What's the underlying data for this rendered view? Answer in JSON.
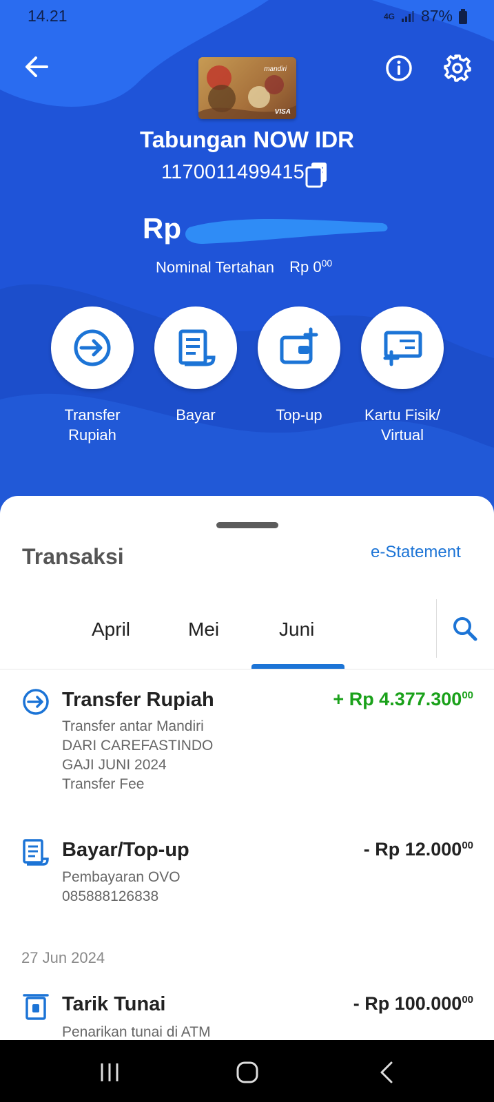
{
  "status_bar": {
    "time": "14.21",
    "network": "4G",
    "battery": "87%"
  },
  "account": {
    "title": "Tabungan NOW IDR",
    "number": "1170011499415",
    "balance_prefix": "Rp",
    "held_label": "Nominal Tertahan",
    "held_amount": "Rp 0",
    "held_cents": "00",
    "card_brand": "VISA",
    "card_bank": "mandiri"
  },
  "actions": [
    {
      "label_line1": "Transfer",
      "label_line2": "Rupiah",
      "icon": "transfer-icon"
    },
    {
      "label_line1": "Bayar",
      "label_line2": "",
      "icon": "bill-icon"
    },
    {
      "label_line1": "Top-up",
      "label_line2": "",
      "icon": "wallet-plus-icon"
    },
    {
      "label_line1": "Kartu Fisik/",
      "label_line2": "Virtual",
      "icon": "card-plus-icon"
    }
  ],
  "transactions_section": {
    "heading": "Transaksi",
    "estatement": "e-Statement",
    "tabs": [
      "April",
      "Mei",
      "Juni"
    ],
    "active_tab": "Juni"
  },
  "transactions": [
    {
      "title": "Transfer Rupiah",
      "amount": "+ Rp 4.377.300",
      "cents": "00",
      "amount_color": "#1aa11a",
      "details": [
        "Transfer antar Mandiri",
        "DARI CAREFASTINDO",
        "GAJI JUNI 2024",
        "Transfer Fee"
      ]
    },
    {
      "title": "Bayar/Top-up",
      "amount": "- Rp 12.000",
      "cents": "00",
      "amount_color": "#222222",
      "details": [
        "Pembayaran OVO",
        "085888126838"
      ]
    },
    {
      "date": "27 Jun 2024",
      "title": "Tarik Tunai",
      "amount": "- Rp 100.000",
      "cents": "00",
      "amount_color": "#222222",
      "details": [
        "Penarikan tunai di ATM"
      ]
    }
  ],
  "colors": {
    "hero_blue": "#1f54d8",
    "accent": "#1c74d6",
    "positive": "#1aa11a"
  }
}
